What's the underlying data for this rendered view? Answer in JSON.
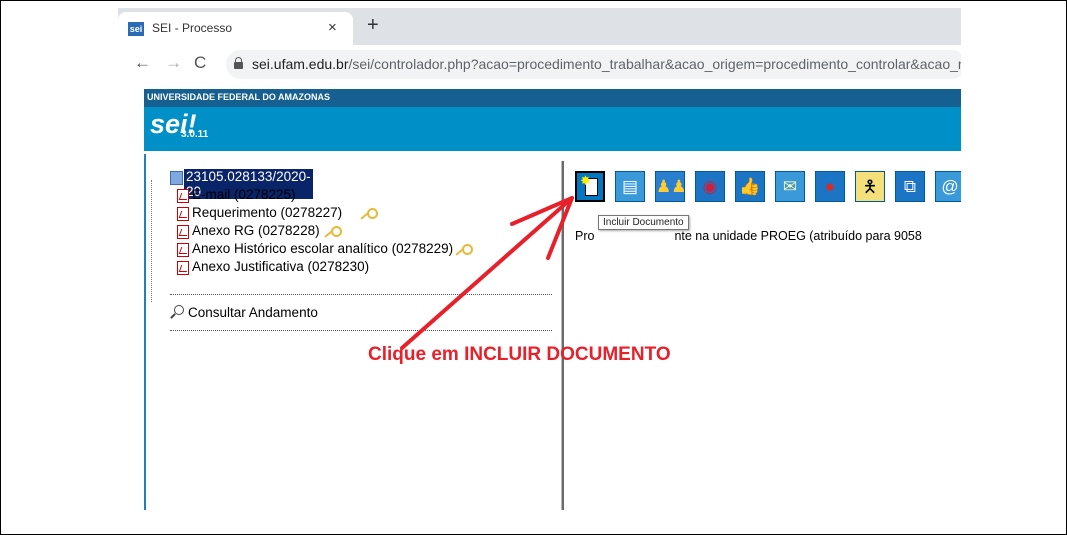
{
  "browser": {
    "tab_title": "SEI - Processo",
    "tab_favicon": "sei",
    "tab_close": "×",
    "new_tab": "+",
    "url_host": "sei.ufam.edu.br",
    "url_path": "/sei/controlador.php?acao=procedimento_trabalhar&acao_origem=procedimento_controlar&acao_retorno",
    "nav": {
      "back": "←",
      "forward": "→",
      "reload": "C"
    }
  },
  "header": {
    "university": "UNIVERSIDADE FEDERAL DO AMAZONAS",
    "logo": "sei!",
    "version": "3.0.11",
    "colors": {
      "topbar": "#155f91",
      "bar": "#0090c8"
    }
  },
  "tree": {
    "process_number": "23105.028133/2020-20",
    "documents": [
      {
        "label": "E-mail (0278225)",
        "key": false
      },
      {
        "label": "Requerimento (0278227)",
        "key": true
      },
      {
        "label": "Anexo RG (0278228)",
        "key": true
      },
      {
        "label": "Anexo Histórico escolar analítico (0278229)",
        "key": true
      },
      {
        "label": "Anexo Justificativa (0278230)",
        "key": false
      }
    ],
    "consult": "Consultar Andamento"
  },
  "toolbar": {
    "icons": [
      "new-document-icon",
      "info-icon",
      "people-icon",
      "eye-icon",
      "thumbs-up-icon",
      "envelope-icon",
      "globe-icon",
      "person-icon",
      "documents-icon",
      "at-icon"
    ],
    "tooltip": "Incluir Documento"
  },
  "status": {
    "prefix": "Pro",
    "suffix": "nte na unidade PROEG (atribuído para 9058"
  },
  "annotation": {
    "text": "Clique em INCLUIR DOCUMENTO",
    "color": "#e8202a"
  }
}
